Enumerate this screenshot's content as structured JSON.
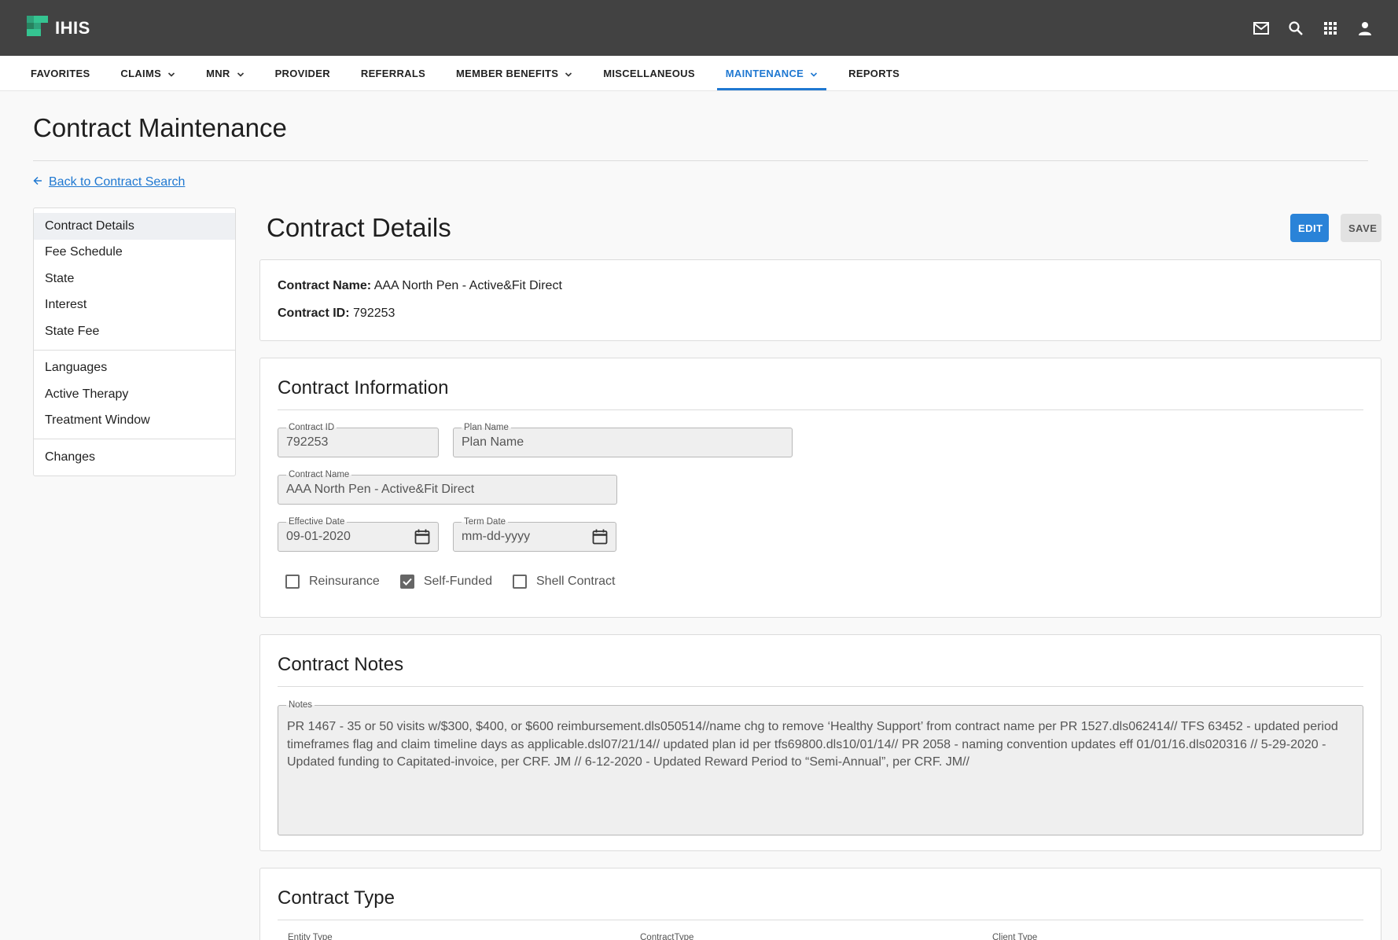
{
  "app": {
    "name": "IHIS",
    "colors": {
      "topbar": "#424242",
      "accent": "#1f78d1",
      "logo_green": "#2fa37c"
    }
  },
  "top_icons": [
    "mail-icon",
    "search-icon",
    "apps-grid-icon",
    "account-icon"
  ],
  "nav": {
    "items": [
      {
        "label": "FAVORITES",
        "dropdown": false
      },
      {
        "label": "CLAIMS",
        "dropdown": true
      },
      {
        "label": "MNR",
        "dropdown": true
      },
      {
        "label": "PROVIDER",
        "dropdown": false
      },
      {
        "label": "REFERRALS",
        "dropdown": false
      },
      {
        "label": "MEMBER BENEFITS",
        "dropdown": true
      },
      {
        "label": "MISCELLANEOUS",
        "dropdown": false
      },
      {
        "label": "MAINTENANCE",
        "dropdown": true,
        "active": true
      },
      {
        "label": "REPORTS",
        "dropdown": false
      }
    ]
  },
  "page": {
    "title": "Contract Maintenance",
    "back_link": "Back to Contract Search"
  },
  "sidebar": {
    "groups": [
      [
        "Contract Details",
        "Fee Schedule",
        "State",
        "Interest",
        "State Fee"
      ],
      [
        "Languages",
        "Active Therapy",
        "Treatment Window"
      ],
      [
        "Changes"
      ]
    ],
    "active": "Contract Details"
  },
  "main": {
    "title": "Contract Details",
    "edit_label": "EDIT",
    "save_label": "SAVE"
  },
  "summary": {
    "name_label": "Contract Name:",
    "name_value": "AAA North Pen - Active&Fit Direct",
    "id_label": "Contract ID:",
    "id_value": "792253"
  },
  "contract_info": {
    "heading": "Contract Information",
    "contract_id": {
      "label": "Contract ID",
      "value": "792253"
    },
    "plan_name": {
      "label": "Plan Name",
      "value": "Plan Name"
    },
    "contract_name": {
      "label": "Contract Name",
      "value": "AAA North Pen - Active&Fit Direct"
    },
    "effective_date": {
      "label": "Effective Date",
      "value": "09-01-2020"
    },
    "term_date": {
      "label": "Term Date",
      "value": "mm-dd-yyyy"
    },
    "checkboxes": [
      {
        "label": "Reinsurance",
        "checked": false
      },
      {
        "label": "Self-Funded",
        "checked": true
      },
      {
        "label": "Shell Contract",
        "checked": false
      }
    ]
  },
  "contract_notes": {
    "heading": "Contract Notes",
    "label": "Notes",
    "value": "PR 1467 - 35 or 50 visits w/$300, $400, or $600 reimbursement.dls050514//name chg to remove ‘Healthy Support’ from contract name per PR 1527.dls062414// TFS 63452 - updated period timeframes flag and claim timeline days as applicable.dsl07/21/14// updated plan id per tfs69800.dls10/01/14// PR 2058 - naming convention updates eff 01/01/16.dls020316 // 5-29-2020 - Updated funding to Capitated-invoice, per CRF. JM // 6-12-2020 - Updated Reward Period to “Semi-Annual”, per CRF. JM//"
  },
  "contract_type": {
    "heading": "Contract Type",
    "field_labels": [
      "Entity Type",
      "ContractType",
      "Client Type"
    ]
  }
}
